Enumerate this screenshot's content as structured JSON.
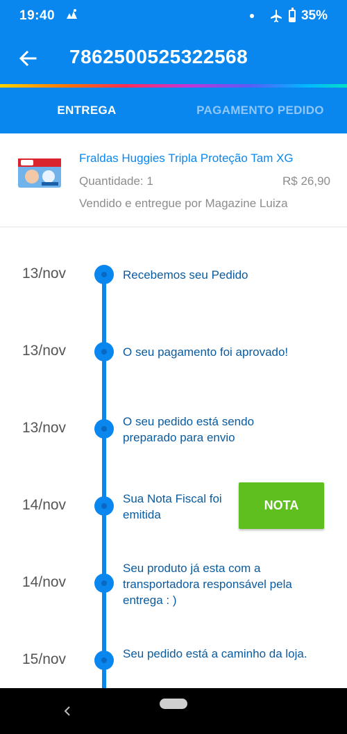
{
  "status_bar": {
    "time": "19:40",
    "battery_percent": "35%",
    "battery_level": 0.35,
    "icons": [
      "notification-icon",
      "airplane-icon",
      "battery-icon"
    ]
  },
  "app_bar": {
    "order_number": "7862500525322568",
    "back_icon": "arrow-left-icon"
  },
  "tabs": [
    {
      "label": "ENTREGA",
      "active": true
    },
    {
      "label": "PAGAMENTO PEDIDO",
      "active": false
    }
  ],
  "product": {
    "name": "Fraldas Huggies Tripla Proteção Tam XG",
    "quantity": "Quantidade: 1",
    "price": "R$ 26,90",
    "seller": "Vendido e entregue por Magazine Luiza"
  },
  "timeline": [
    {
      "date": "13/nov",
      "text": "Recebemos seu Pedido"
    },
    {
      "date": "13/nov",
      "text": "O seu pagamento foi aprovado!"
    },
    {
      "date": "13/nov",
      "text": "O seu pedido está sendo preparado para envio"
    },
    {
      "date": "14/nov",
      "text": "Sua Nota Fiscal foi emitida",
      "button": "NOTA"
    },
    {
      "date": "14/nov",
      "text": "Seu produto já esta com a transportadora responsável pela entrega : )"
    },
    {
      "date": "15/nov",
      "text": "Seu pedido está a caminho da loja."
    }
  ],
  "colors": {
    "primary": "#0a87ee",
    "nota_button": "#5fbf1f",
    "timeline_text": "#0a5a9e"
  }
}
